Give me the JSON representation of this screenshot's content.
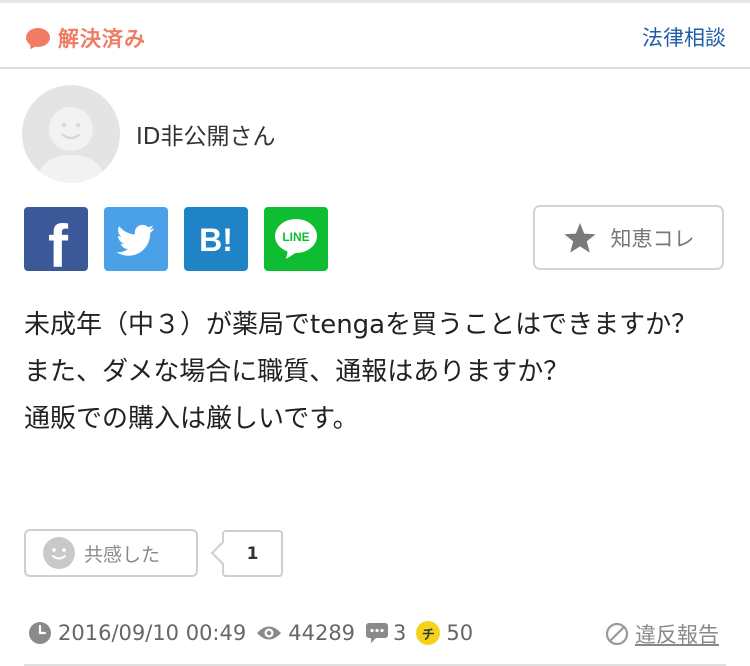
{
  "header": {
    "status_label": "解決済み",
    "category": "法律相談"
  },
  "user": {
    "name": "ID非公開さん"
  },
  "share": {
    "facebook_glyph": "f",
    "hatena_glyph": "B!",
    "line_glyph": "LINE"
  },
  "chie_button": {
    "label": "知恵コレ"
  },
  "question": {
    "lines": [
      "未成年（中３）が薬局でtengaを買うことはできますか？",
      "また、ダメな場合に職質、通報はありますか？",
      "通販での購入は厳しいです。"
    ]
  },
  "reactions": {
    "empathy_label": "共感した",
    "empathy_count": "1"
  },
  "meta": {
    "datetime": "2016/09/10 00:49",
    "views": "44289",
    "answers": "3",
    "coin_glyph": "チ",
    "coins": "50",
    "report_label": "違反報告"
  },
  "colors": {
    "resolved": "#f07d63",
    "link": "#1f5ea8",
    "facebook": "#3b5998",
    "twitter": "#4aa1e8",
    "hatena": "#1f83c5",
    "line": "#0fbd32",
    "coin": "#f5d21b"
  }
}
